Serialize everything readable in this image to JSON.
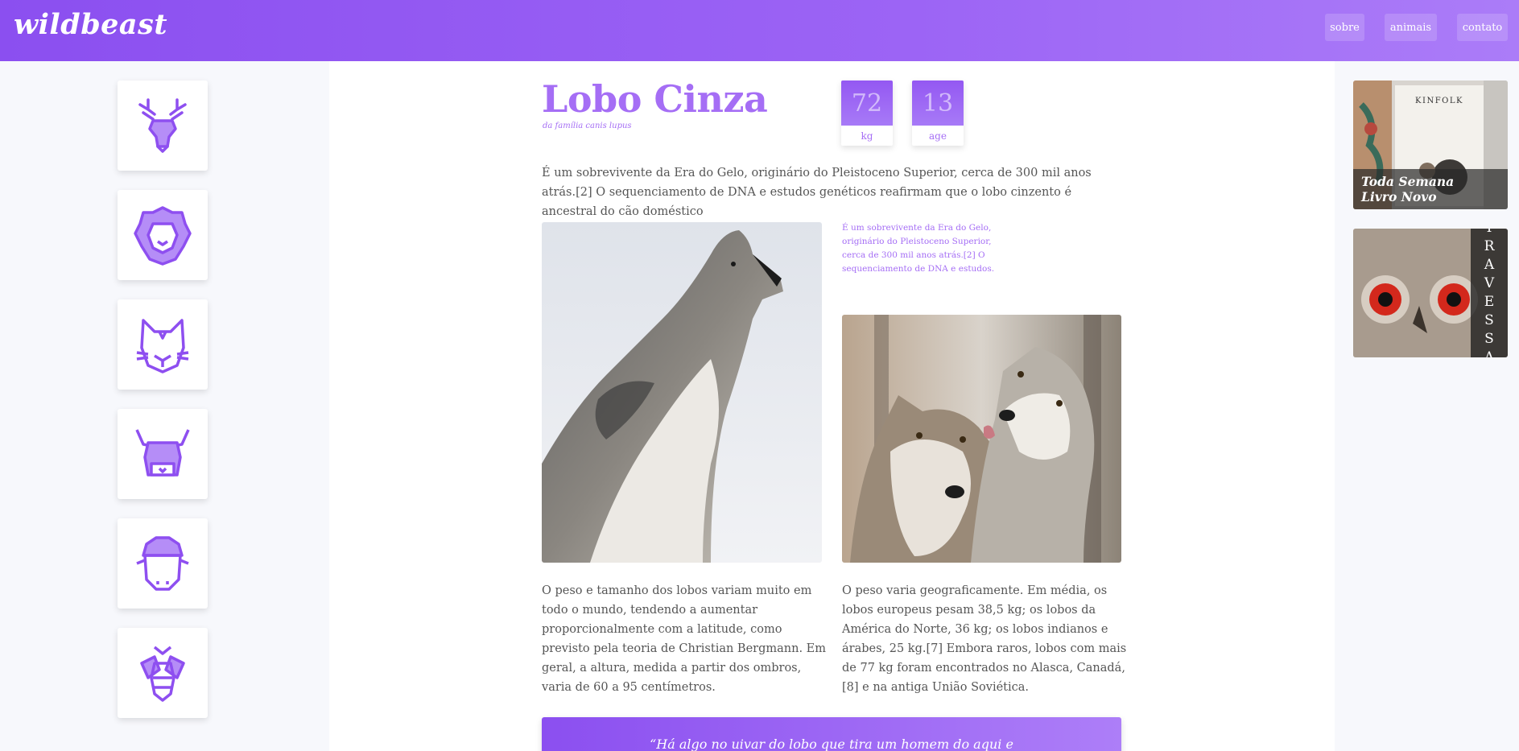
{
  "header": {
    "logo": "wildbeast",
    "nav": [
      {
        "label": "sobre"
      },
      {
        "label": "animais"
      },
      {
        "label": "contato"
      }
    ]
  },
  "sidebar": {
    "icons": [
      "deer-icon",
      "lion-icon",
      "cat-icon",
      "bull-icon",
      "sheep-icon",
      "bee-icon"
    ]
  },
  "animal": {
    "name": "Lobo Cinza",
    "family": "da família canis lupus",
    "stats": [
      {
        "value": "72",
        "label": "kg"
      },
      {
        "value": "13",
        "label": "age"
      }
    ],
    "lead": "É um sobrevivente da Era do Gelo, originário do Pleistoceno Superior, cerca de 300 mil anos atrás.[2] O sequenciamento de DNA e estudos genéticos reafirmam que o lobo cinzento é ancestral do cão doméstico",
    "side_note": "É um sobrevivente da Era do Gelo, originário do Pleistoceno Superior, cerca de 300 mil anos atrás.[2] O sequenciamento de DNA e estudos.",
    "para_left": "O peso e tamanho dos lobos variam muito em todo o mundo, tendendo a aumentar proporcionalmente com a latitude, como previsto pela teoria de Christian Bergmann. Em geral, a altura, medida a partir dos ombros, varia de 60 a 95 centímetros.",
    "para_right": "O peso varia geograficamente. Em média, os lobos europeus pesam 38,5 kg; os lobos da América do Norte, 36 kg; os lobos indianos e árabes, 25 kg.[7] Embora raros, lobos com mais de 77 kg foram encontrados no Alasca, Canadá,[8] e na antiga União Soviética.",
    "quote": "“Há algo no uivar do lobo que tira um homem do aqui e"
  },
  "ads": [
    {
      "caption_line1": "Toda Semana",
      "caption_line2": "Livro Novo",
      "book_label": "KINFOLK"
    },
    {
      "vertical_letters": [
        "T",
        "R",
        "A",
        "V",
        "E",
        "S",
        "S",
        "A"
      ]
    }
  ],
  "colors": {
    "accent": "#a56ef5",
    "header_start": "#8b4ff0",
    "header_end": "#ab7cf8"
  }
}
